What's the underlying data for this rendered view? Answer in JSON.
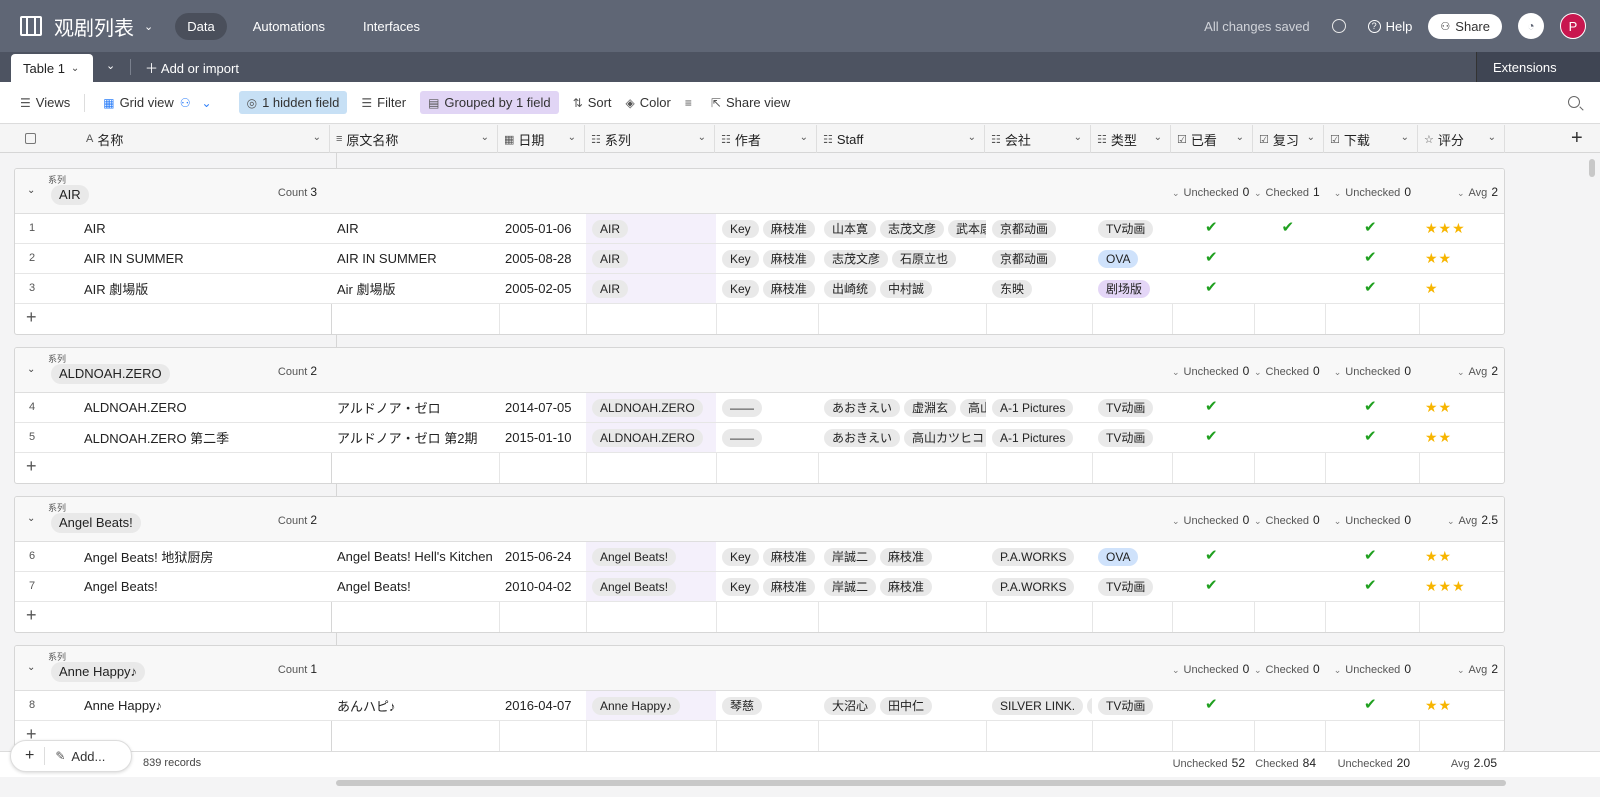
{
  "app": {
    "base_title": "观剧列表",
    "tabs": [
      {
        "label": "Data"
      },
      {
        "label": "Automations"
      },
      {
        "label": "Interfaces"
      }
    ],
    "saved_status": "All changes saved",
    "help_label": "Help",
    "share_label": "Share",
    "avatar_initial": "P"
  },
  "tables": {
    "current": "Table 1",
    "add_import": "Add or import",
    "extensions": "Extensions"
  },
  "toolbar": {
    "views": "Views",
    "grid_view": "Grid view",
    "hidden_fields": "1 hidden field",
    "filter": "Filter",
    "grouped": "Grouped by 1 field",
    "sort": "Sort",
    "color": "Color",
    "share_view": "Share view"
  },
  "columns": [
    {
      "name": "名称",
      "icon": "A"
    },
    {
      "name": "原文名称",
      "icon": "≡"
    },
    {
      "name": "日期",
      "icon": "▦"
    },
    {
      "name": "系列",
      "icon": "☷"
    },
    {
      "name": "作者",
      "icon": "☷"
    },
    {
      "name": "Staff",
      "icon": "☷"
    },
    {
      "name": "会社",
      "icon": "☷"
    },
    {
      "name": "类型",
      "icon": "☷"
    },
    {
      "name": "已看",
      "icon": "☑"
    },
    {
      "name": "复习",
      "icon": "☑"
    },
    {
      "name": "下载",
      "icon": "☑"
    },
    {
      "name": "评分",
      "icon": "☆"
    }
  ],
  "group_field_label": "系列",
  "groups": [
    {
      "name": "AIR",
      "count_label": "Count",
      "count": "3",
      "summary": {
        "watched": "Unchecked",
        "watched_n": "0",
        "review": "Checked",
        "review_n": "1",
        "download": "Unchecked",
        "download_n": "0",
        "rating": "Avg",
        "rating_n": "2"
      },
      "rows": [
        {
          "num": "1",
          "name": "AIR",
          "orig": "AIR",
          "date": "2005-01-06",
          "series": "AIR",
          "author": [
            "Key",
            "麻枝准"
          ],
          "staff": [
            "山本寛",
            "志茂文彦",
            "武本康"
          ],
          "company": [
            "京都动画"
          ],
          "type": "TV动画",
          "type_color": "gray",
          "watched": true,
          "review": true,
          "download": true,
          "rating": "★★★"
        },
        {
          "num": "2",
          "name": "AIR IN SUMMER",
          "orig": "AIR IN SUMMER",
          "date": "2005-08-28",
          "series": "AIR",
          "author": [
            "Key",
            "麻枝准"
          ],
          "staff": [
            "志茂文彦",
            "石原立也"
          ],
          "company": [
            "京都动画"
          ],
          "type": "OVA",
          "type_color": "blue",
          "watched": true,
          "review": false,
          "download": true,
          "rating": "★★"
        },
        {
          "num": "3",
          "name": "AIR 劇場版",
          "orig": "Air 劇場版",
          "date": "2005-02-05",
          "series": "AIR",
          "author": [
            "Key",
            "麻枝准"
          ],
          "staff": [
            "出崎统",
            "中村誠"
          ],
          "company": [
            "东映"
          ],
          "type": "剧场版",
          "type_color": "purple",
          "watched": true,
          "review": false,
          "download": true,
          "rating": "★"
        }
      ]
    },
    {
      "name": "ALDNOAH.ZERO",
      "count_label": "Count",
      "count": "2",
      "summary": {
        "watched": "Unchecked",
        "watched_n": "0",
        "review": "Checked",
        "review_n": "0",
        "download": "Unchecked",
        "download_n": "0",
        "rating": "Avg",
        "rating_n": "2"
      },
      "rows": [
        {
          "num": "4",
          "name": "ALDNOAH.ZERO",
          "orig": "アルドノア・ゼロ",
          "date": "2014-07-05",
          "series": "ALDNOAH.ZERO",
          "author": [
            "——"
          ],
          "staff": [
            "あおきえい",
            "虚淵玄",
            "高山"
          ],
          "company": [
            "A-1 Pictures"
          ],
          "type": "TV动画",
          "type_color": "gray",
          "watched": true,
          "review": false,
          "download": true,
          "rating": "★★"
        },
        {
          "num": "5",
          "name": "ALDNOAH.ZERO 第二季",
          "orig": "アルドノア・ゼロ 第2期",
          "date": "2015-01-10",
          "series": "ALDNOAH.ZERO",
          "author": [
            "——"
          ],
          "staff": [
            "あおきえい",
            "高山カツヒコ"
          ],
          "company": [
            "A-1 Pictures"
          ],
          "type": "TV动画",
          "type_color": "gray",
          "watched": true,
          "review": false,
          "download": true,
          "rating": "★★"
        }
      ]
    },
    {
      "name": "Angel Beats!",
      "count_label": "Count",
      "count": "2",
      "summary": {
        "watched": "Unchecked",
        "watched_n": "0",
        "review": "Checked",
        "review_n": "0",
        "download": "Unchecked",
        "download_n": "0",
        "rating": "Avg",
        "rating_n": "2.5"
      },
      "rows": [
        {
          "num": "6",
          "name": "Angel Beats! 地狱厨房",
          "orig": "Angel Beats! Hell's Kitchen",
          "date": "2015-06-24",
          "series": "Angel Beats!",
          "author": [
            "Key",
            "麻枝准"
          ],
          "staff": [
            "岸誠二",
            "麻枝准"
          ],
          "company": [
            "P.A.WORKS"
          ],
          "type": "OVA",
          "type_color": "blue",
          "watched": true,
          "review": false,
          "download": true,
          "rating": "★★"
        },
        {
          "num": "7",
          "name": "Angel Beats!",
          "orig": "Angel Beats!",
          "date": "2010-04-02",
          "series": "Angel Beats!",
          "author": [
            "Key",
            "麻枝准"
          ],
          "staff": [
            "岸誠二",
            "麻枝准"
          ],
          "company": [
            "P.A.WORKS"
          ],
          "type": "TV动画",
          "type_color": "gray",
          "watched": true,
          "review": false,
          "download": true,
          "rating": "★★★"
        }
      ]
    },
    {
      "name": "Anne Happy♪",
      "count_label": "Count",
      "count": "1",
      "summary": {
        "watched": "Unchecked",
        "watched_n": "0",
        "review": "Checked",
        "review_n": "0",
        "download": "Unchecked",
        "download_n": "0",
        "rating": "Avg",
        "rating_n": "2"
      },
      "rows": [
        {
          "num": "8",
          "name": "Anne Happy♪",
          "orig": "あんハピ♪",
          "date": "2016-04-07",
          "series": "Anne Happy♪",
          "author": [
            "琴慈"
          ],
          "staff": [
            "大沼心",
            "田中仁"
          ],
          "company": [
            "SILVER LINK.",
            "ヨ"
          ],
          "type": "TV动画",
          "type_color": "gray",
          "watched": true,
          "review": false,
          "download": true,
          "rating": "★★"
        }
      ]
    }
  ],
  "footer": {
    "add_label": "Add...",
    "records": "839 records",
    "watched": "Unchecked",
    "watched_n": "52",
    "review": "Checked",
    "review_n": "84",
    "download": "Unchecked",
    "download_n": "20",
    "rating": "Avg",
    "rating_n": "2.05"
  },
  "colors": {
    "topbar": "#5f6675",
    "tabsbar": "#4d5361",
    "check": "#20a020",
    "star": "#f7b500",
    "hidden_pill": "#c7e0f5",
    "group_pill": "#e1d5f5"
  }
}
